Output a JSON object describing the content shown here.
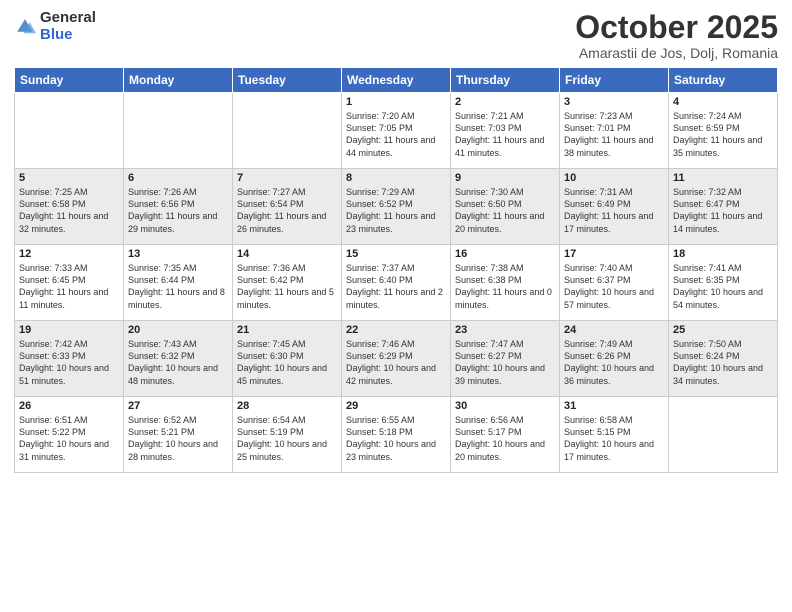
{
  "logo": {
    "general": "General",
    "blue": "Blue"
  },
  "header": {
    "month": "October 2025",
    "subtitle": "Amarastii de Jos, Dolj, Romania"
  },
  "weekdays": [
    "Sunday",
    "Monday",
    "Tuesday",
    "Wednesday",
    "Thursday",
    "Friday",
    "Saturday"
  ],
  "weeks": [
    [
      {
        "day": "",
        "info": ""
      },
      {
        "day": "",
        "info": ""
      },
      {
        "day": "",
        "info": ""
      },
      {
        "day": "1",
        "info": "Sunrise: 7:20 AM\nSunset: 7:05 PM\nDaylight: 11 hours\nand 44 minutes."
      },
      {
        "day": "2",
        "info": "Sunrise: 7:21 AM\nSunset: 7:03 PM\nDaylight: 11 hours\nand 41 minutes."
      },
      {
        "day": "3",
        "info": "Sunrise: 7:23 AM\nSunset: 7:01 PM\nDaylight: 11 hours\nand 38 minutes."
      },
      {
        "day": "4",
        "info": "Sunrise: 7:24 AM\nSunset: 6:59 PM\nDaylight: 11 hours\nand 35 minutes."
      }
    ],
    [
      {
        "day": "5",
        "info": "Sunrise: 7:25 AM\nSunset: 6:58 PM\nDaylight: 11 hours\nand 32 minutes."
      },
      {
        "day": "6",
        "info": "Sunrise: 7:26 AM\nSunset: 6:56 PM\nDaylight: 11 hours\nand 29 minutes."
      },
      {
        "day": "7",
        "info": "Sunrise: 7:27 AM\nSunset: 6:54 PM\nDaylight: 11 hours\nand 26 minutes."
      },
      {
        "day": "8",
        "info": "Sunrise: 7:29 AM\nSunset: 6:52 PM\nDaylight: 11 hours\nand 23 minutes."
      },
      {
        "day": "9",
        "info": "Sunrise: 7:30 AM\nSunset: 6:50 PM\nDaylight: 11 hours\nand 20 minutes."
      },
      {
        "day": "10",
        "info": "Sunrise: 7:31 AM\nSunset: 6:49 PM\nDaylight: 11 hours\nand 17 minutes."
      },
      {
        "day": "11",
        "info": "Sunrise: 7:32 AM\nSunset: 6:47 PM\nDaylight: 11 hours\nand 14 minutes."
      }
    ],
    [
      {
        "day": "12",
        "info": "Sunrise: 7:33 AM\nSunset: 6:45 PM\nDaylight: 11 hours\nand 11 minutes."
      },
      {
        "day": "13",
        "info": "Sunrise: 7:35 AM\nSunset: 6:44 PM\nDaylight: 11 hours\nand 8 minutes."
      },
      {
        "day": "14",
        "info": "Sunrise: 7:36 AM\nSunset: 6:42 PM\nDaylight: 11 hours\nand 5 minutes."
      },
      {
        "day": "15",
        "info": "Sunrise: 7:37 AM\nSunset: 6:40 PM\nDaylight: 11 hours\nand 2 minutes."
      },
      {
        "day": "16",
        "info": "Sunrise: 7:38 AM\nSunset: 6:38 PM\nDaylight: 11 hours\nand 0 minutes."
      },
      {
        "day": "17",
        "info": "Sunrise: 7:40 AM\nSunset: 6:37 PM\nDaylight: 10 hours\nand 57 minutes."
      },
      {
        "day": "18",
        "info": "Sunrise: 7:41 AM\nSunset: 6:35 PM\nDaylight: 10 hours\nand 54 minutes."
      }
    ],
    [
      {
        "day": "19",
        "info": "Sunrise: 7:42 AM\nSunset: 6:33 PM\nDaylight: 10 hours\nand 51 minutes."
      },
      {
        "day": "20",
        "info": "Sunrise: 7:43 AM\nSunset: 6:32 PM\nDaylight: 10 hours\nand 48 minutes."
      },
      {
        "day": "21",
        "info": "Sunrise: 7:45 AM\nSunset: 6:30 PM\nDaylight: 10 hours\nand 45 minutes."
      },
      {
        "day": "22",
        "info": "Sunrise: 7:46 AM\nSunset: 6:29 PM\nDaylight: 10 hours\nand 42 minutes."
      },
      {
        "day": "23",
        "info": "Sunrise: 7:47 AM\nSunset: 6:27 PM\nDaylight: 10 hours\nand 39 minutes."
      },
      {
        "day": "24",
        "info": "Sunrise: 7:49 AM\nSunset: 6:26 PM\nDaylight: 10 hours\nand 36 minutes."
      },
      {
        "day": "25",
        "info": "Sunrise: 7:50 AM\nSunset: 6:24 PM\nDaylight: 10 hours\nand 34 minutes."
      }
    ],
    [
      {
        "day": "26",
        "info": "Sunrise: 6:51 AM\nSunset: 5:22 PM\nDaylight: 10 hours\nand 31 minutes."
      },
      {
        "day": "27",
        "info": "Sunrise: 6:52 AM\nSunset: 5:21 PM\nDaylight: 10 hours\nand 28 minutes."
      },
      {
        "day": "28",
        "info": "Sunrise: 6:54 AM\nSunset: 5:19 PM\nDaylight: 10 hours\nand 25 minutes."
      },
      {
        "day": "29",
        "info": "Sunrise: 6:55 AM\nSunset: 5:18 PM\nDaylight: 10 hours\nand 23 minutes."
      },
      {
        "day": "30",
        "info": "Sunrise: 6:56 AM\nSunset: 5:17 PM\nDaylight: 10 hours\nand 20 minutes."
      },
      {
        "day": "31",
        "info": "Sunrise: 6:58 AM\nSunset: 5:15 PM\nDaylight: 10 hours\nand 17 minutes."
      },
      {
        "day": "",
        "info": ""
      }
    ]
  ]
}
